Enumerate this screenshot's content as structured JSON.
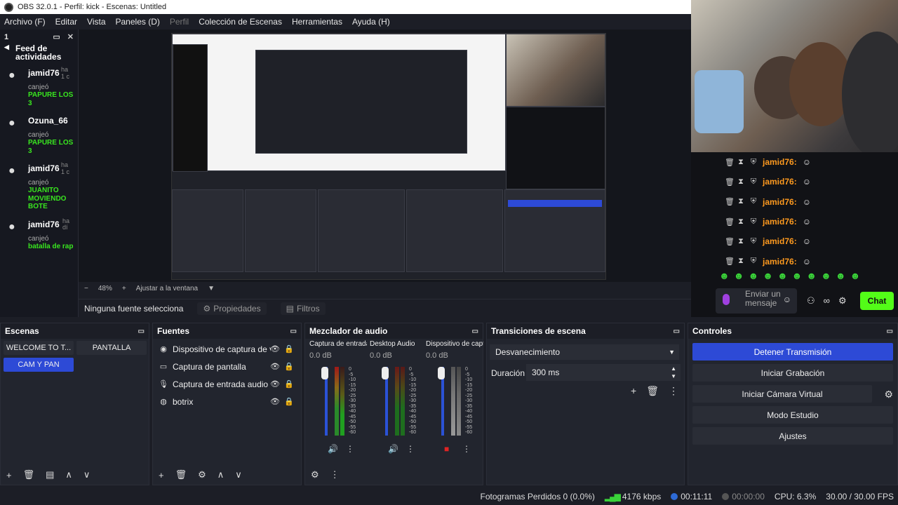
{
  "window": {
    "title": "OBS 32.0.1 - Perfil: kick - Escenas: Untitled"
  },
  "menu": [
    "Archivo (F)",
    "Editar",
    "Vista",
    "Paneles (D)",
    "Perfil",
    "Colección de Escenas",
    "Herramientas",
    "Ayuda (H)"
  ],
  "activity_dock": {
    "tab_label": "1",
    "title": "Feed de actividades",
    "items": [
      {
        "user": "jamid76",
        "ago": "ha\n1 c",
        "verb": "canjeó",
        "reward": "PAPURE LOS 3"
      },
      {
        "user": "Ozuna_66",
        "ago": "",
        "verb": "canjeó",
        "reward": "PAPURE LOS 3"
      },
      {
        "user": "jamid76",
        "ago": "ha\n1 c",
        "verb": "canjeó",
        "reward": "JUANITO MOVIENDO BOTE"
      },
      {
        "user": "jamid76",
        "ago": "ha\ndí",
        "verb": "canjeó",
        "reward": "batalla de rap"
      }
    ]
  },
  "preview_controls": {
    "zoom": "48%",
    "fit": "Ajustar a la ventana"
  },
  "selection_bar": {
    "no_source": "Ninguna fuente selecciona",
    "properties": "Propiedades",
    "filters": "Filtros"
  },
  "chat": {
    "rows": [
      {
        "user": "jamid76:",
        "emote": "☺"
      },
      {
        "user": "jamid76:",
        "emote": "☺"
      },
      {
        "user": "jamid76:",
        "emote": "☺"
      },
      {
        "user": "jamid76:",
        "emote": "☺"
      },
      {
        "user": "jamid76:",
        "emote": "☺"
      },
      {
        "user": "jamid76:",
        "emote": "☺"
      }
    ],
    "input_placeholder": "Enviar un mensaje",
    "send_label": "Chat",
    "accent": "#53fc18"
  },
  "scenes": {
    "title": "Escenas",
    "items": [
      {
        "label": "WELCOME TO T...",
        "active": false
      },
      {
        "label": "PANTALLA",
        "active": false
      },
      {
        "label": "CAM Y PAN",
        "active": true
      }
    ]
  },
  "sources": {
    "title": "Fuentes",
    "items": [
      {
        "label": "Dispositivo de captura de v",
        "icon": "camera-icon"
      },
      {
        "label": "Captura de pantalla",
        "icon": "monitor-icon"
      },
      {
        "label": "Captura de entrada audio",
        "icon": "microphone-icon"
      },
      {
        "label": "botrix",
        "icon": "globe-icon"
      }
    ]
  },
  "mixer": {
    "title": "Mezclador de audio",
    "channels": [
      {
        "name": "Captura de entrada",
        "db": "0.0 dB",
        "muted": false
      },
      {
        "name": "Desktop Audio",
        "db": "0.0 dB",
        "muted": false
      },
      {
        "name": "Dispositivo de capt",
        "db": "0.0 dB",
        "muted": true
      }
    ],
    "scale": [
      "0",
      "-5",
      "-10",
      "-15",
      "-20",
      "-25",
      "-30",
      "-35",
      "-40",
      "-45",
      "-50",
      "-55",
      "-60"
    ]
  },
  "transitions": {
    "title": "Transiciones de escena",
    "selected": "Desvanecimiento",
    "duration_label": "Duración",
    "duration_value": "300 ms"
  },
  "controls": {
    "title": "Controles",
    "buttons": [
      "Detener Transmisión",
      "Iniciar Grabación",
      "Iniciar Cámara Virtual",
      "Modo Estudio",
      "Ajustes"
    ],
    "accent": "#2d4ad6"
  },
  "status": {
    "dropped": "Fotogramas Perdidos 0 (0.0%)",
    "bitrate": "4176 kbps",
    "stream_time": "00:11:11",
    "rec_time": "00:00:00",
    "cpu": "CPU: 6.3%",
    "fps": "30.00 / 30.00 FPS"
  }
}
